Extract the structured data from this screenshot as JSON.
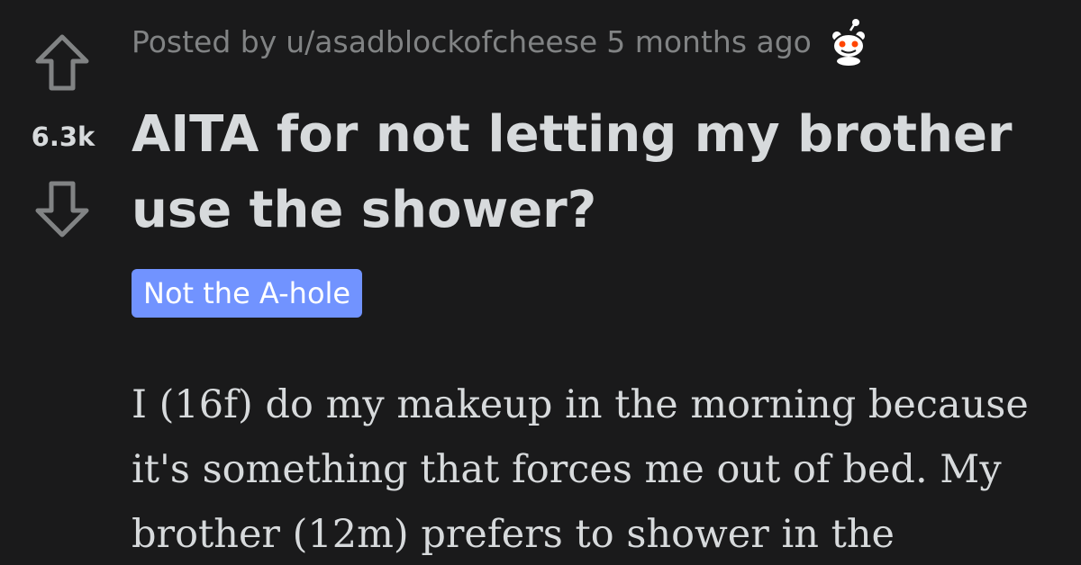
{
  "post": {
    "score": "6.3k",
    "meta": {
      "prefix": "Posted by",
      "author": "u/asadblockofcheese",
      "age": "5 months ago"
    },
    "title": "AITA for not letting my brother use the shower?",
    "flair": "Not the A-hole",
    "body": "I (16f) do my makeup in the morning because it's something that forces me out of bed. My brother (12m) prefers to shower in the"
  },
  "icons": {
    "upvote": "upvote-arrow-icon",
    "downvote": "downvote-arrow-icon",
    "award": "snoo-award-icon"
  },
  "colors": {
    "background": "#1a1a1b",
    "text": "#d7dadc",
    "meta_text": "#818384",
    "flair_bg": "#7193ff",
    "flair_text": "#ffffff"
  }
}
